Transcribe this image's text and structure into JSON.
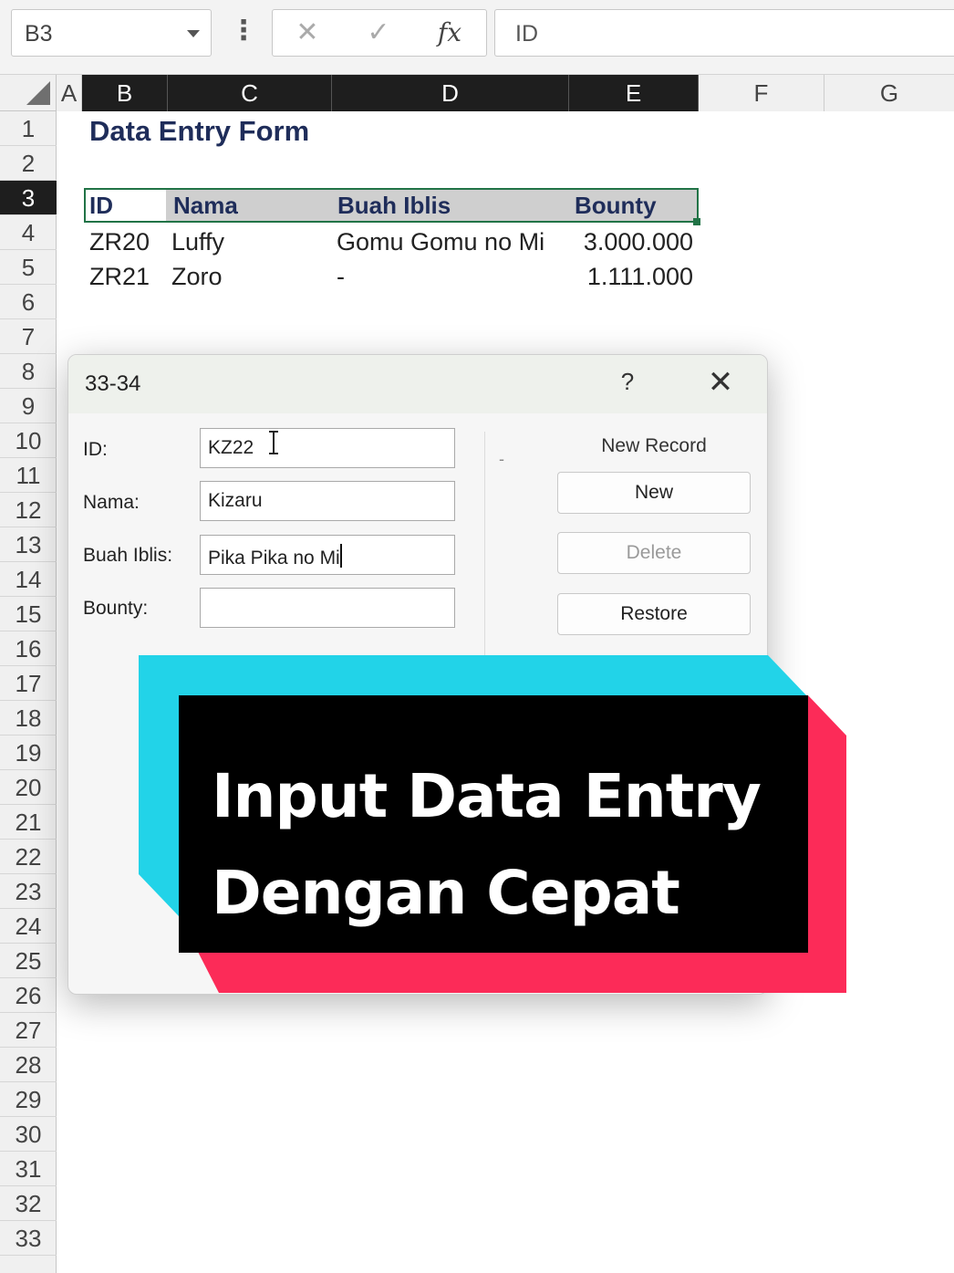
{
  "formula_bar": {
    "name_box": "B3",
    "cancel_icon": "✕",
    "enter_icon": "✓",
    "function_icon": "fx",
    "formula_value": "ID",
    "more_icon": "⋮"
  },
  "columns": [
    "A",
    "B",
    "C",
    "D",
    "E",
    "F",
    "G"
  ],
  "rows": [
    "1",
    "2",
    "3",
    "4",
    "5",
    "6",
    "7",
    "8",
    "9",
    "10",
    "11",
    "12",
    "13",
    "14",
    "15",
    "16",
    "17",
    "18",
    "19",
    "20",
    "21",
    "22",
    "23",
    "24",
    "25",
    "26",
    "27",
    "28",
    "29",
    "30",
    "31",
    "32",
    "33"
  ],
  "selected_cell": "B3",
  "sheet": {
    "title": "Data Entry Form",
    "headers": [
      "ID",
      "Nama",
      "Buah Iblis",
      "Bounty"
    ],
    "records": [
      {
        "id": "ZR20",
        "nama": "Luffy",
        "buah_iblis": "Gomu Gomu no Mi",
        "bounty": "3.000.000"
      },
      {
        "id": "ZR21",
        "nama": "Zoro",
        "buah_iblis": "-",
        "bounty": "1.111.000"
      }
    ],
    "accent_color": "#217346",
    "title_color": "#1f2d5a"
  },
  "dialog": {
    "title": "33-34",
    "help_label": "?",
    "close_label": "✕",
    "record_status": "New Record",
    "fields": [
      {
        "label": "ID:",
        "value": "KZ22"
      },
      {
        "label": "Nama:",
        "value": "Kizaru"
      },
      {
        "label": "Buah Iblis:",
        "value": "Pika Pika no Mi"
      },
      {
        "label": "Bounty:",
        "value": ""
      }
    ],
    "buttons": {
      "new": "New",
      "delete": "Delete",
      "restore": "Restore"
    },
    "dash": "-"
  },
  "overlay": {
    "line1": "Input Data Entry",
    "line2": "Dengan Cepat",
    "colors": {
      "cyan": "#22d3e8",
      "red": "#fc2b58",
      "black": "#000000"
    }
  }
}
